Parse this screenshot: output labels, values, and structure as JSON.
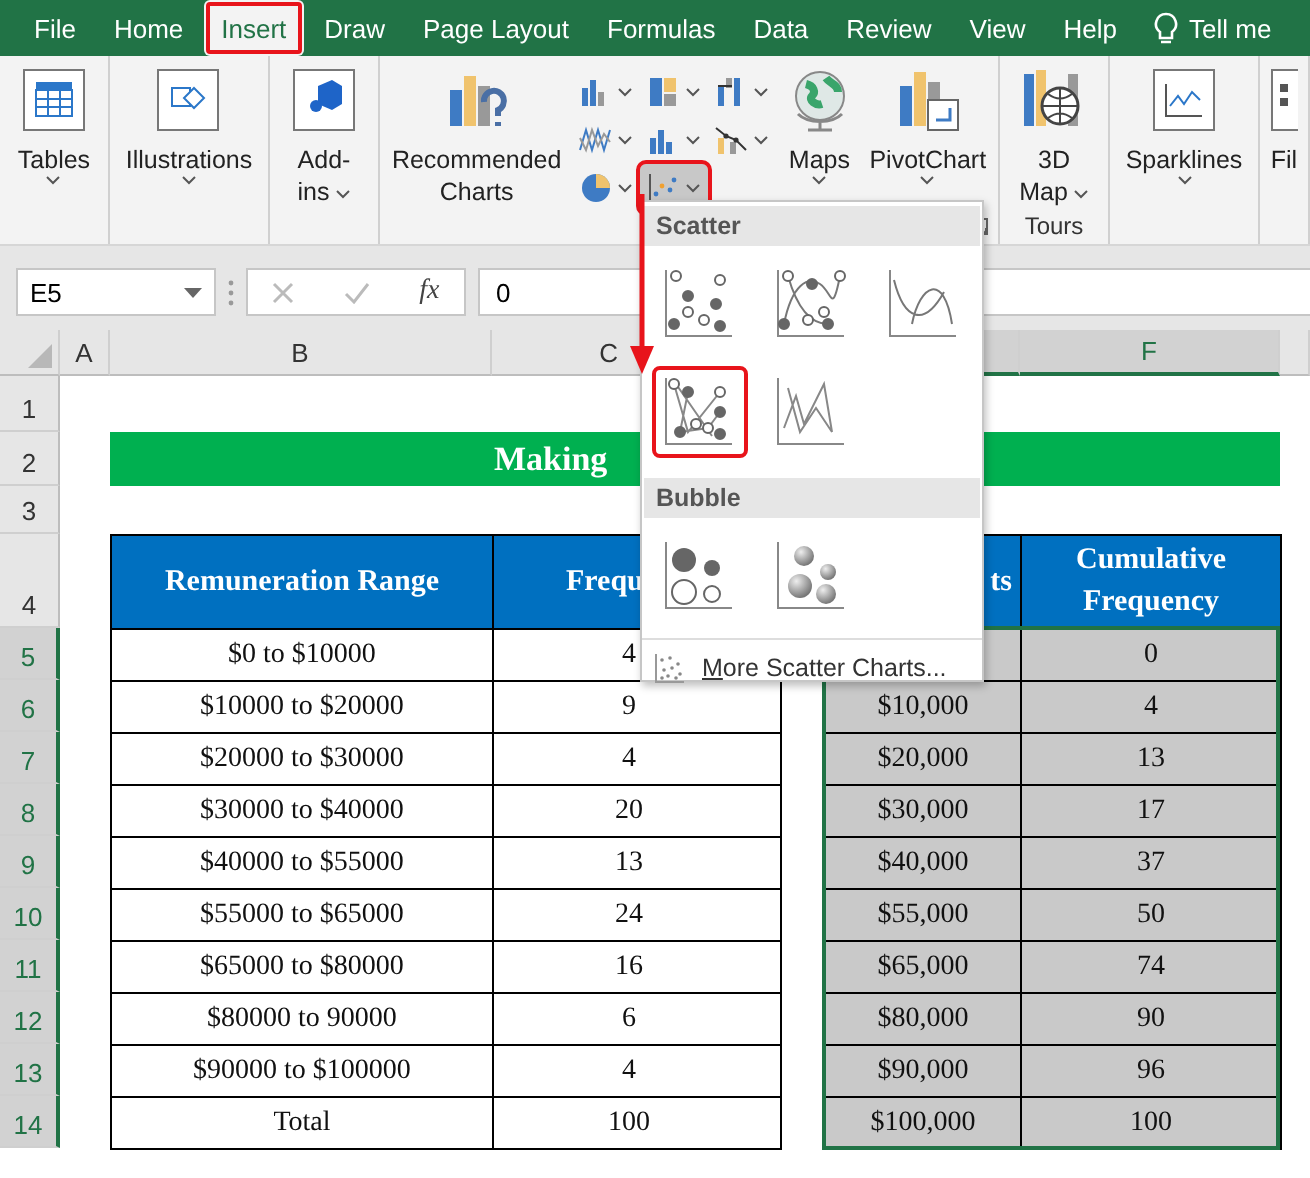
{
  "tabs": [
    {
      "label": "File",
      "selected": false
    },
    {
      "label": "Home",
      "selected": false
    },
    {
      "label": "Insert",
      "selected": true
    },
    {
      "label": "Draw",
      "selected": false
    },
    {
      "label": "Page Layout",
      "selected": false
    },
    {
      "label": "Formulas",
      "selected": false
    },
    {
      "label": "Data",
      "selected": false
    },
    {
      "label": "Review",
      "selected": false
    },
    {
      "label": "View",
      "selected": false
    },
    {
      "label": "Help",
      "selected": false
    }
  ],
  "tell_me": "Tell me",
  "ribbon_groups": [
    {
      "buttons": [
        {
          "kind": "big",
          "label_lines": [
            "Tables"
          ],
          "caret_below": true
        }
      ]
    },
    {
      "buttons": [
        {
          "kind": "big",
          "label_lines": [
            "Illustrations"
          ],
          "caret_below": true
        }
      ]
    },
    {
      "buttons": [
        {
          "kind": "big",
          "label_lines": [
            "Add-",
            "ins"
          ],
          "caret_inline": true
        }
      ]
    },
    {
      "launcher": true,
      "buttons": [
        {
          "kind": "big",
          "label_lines": [
            "Recommended",
            "Charts"
          ]
        },
        {
          "kind": "grid",
          "items": [
            {
              "selected": false
            },
            {
              "selected": false
            },
            {
              "selected": false
            },
            {
              "selected": false
            },
            {
              "selected": false
            },
            {
              "selected": false
            },
            {
              "selected": false
            },
            {
              "selected": true
            }
          ]
        },
        {
          "kind": "big",
          "label_lines": [
            "Maps"
          ],
          "caret_below": true
        },
        {
          "kind": "big",
          "label_lines": [
            "PivotChart"
          ],
          "caret_below": true
        }
      ]
    },
    {
      "label": "Tours",
      "buttons": [
        {
          "kind": "big",
          "label_lines": [
            "3D",
            "Map"
          ],
          "caret_inline": true
        }
      ]
    },
    {
      "buttons": [
        {
          "kind": "big",
          "label_lines": [
            "Sparklines"
          ],
          "caret_below": true
        }
      ]
    },
    {
      "buttons": [
        {
          "kind": "big",
          "label_lines": [
            "Fil"
          ]
        }
      ]
    }
  ],
  "name_box": "E5",
  "function_button": "fx",
  "formula": "0",
  "column_headers": [
    {
      "label": "A",
      "selected": false
    },
    {
      "label": "B",
      "selected": false
    },
    {
      "label": "C",
      "selected": false
    },
    {
      "label": "F",
      "selected": true
    }
  ],
  "row_numbers": [
    {
      "label": "1",
      "selected": false
    },
    {
      "label": "2",
      "selected": false
    },
    {
      "label": "3",
      "selected": false
    },
    {
      "label": "4",
      "selected": false
    },
    {
      "label": "5",
      "selected": true
    },
    {
      "label": "6",
      "selected": true
    },
    {
      "label": "7",
      "selected": true
    },
    {
      "label": "8",
      "selected": true
    },
    {
      "label": "9",
      "selected": true
    },
    {
      "label": "10",
      "selected": true
    },
    {
      "label": "11",
      "selected": true
    },
    {
      "label": "12",
      "selected": true
    },
    {
      "label": "13",
      "selected": true
    },
    {
      "label": "14",
      "selected": true
    }
  ],
  "title": "Making",
  "left_table": {
    "headers": [
      "Remuneration Range",
      "Frequ"
    ],
    "rows": [
      [
        "$0 to $10000",
        "4"
      ],
      [
        "$10000 to $20000",
        "9"
      ],
      [
        "$20000 to $30000",
        "4"
      ],
      [
        "$30000 to $40000",
        "20"
      ],
      [
        "$40000 to $55000",
        "13"
      ],
      [
        "$55000 to $65000",
        "24"
      ],
      [
        "$65000 to $80000",
        "16"
      ],
      [
        "$80000 to 90000",
        "6"
      ],
      [
        "$90000 to $100000",
        "4"
      ],
      [
        "Total",
        "100"
      ]
    ]
  },
  "right_table": {
    "headers": [
      "ts",
      "Cumulative Frequency"
    ],
    "rows": [
      {
        "cumulative": "0"
      },
      {
        "limit": "$10,000",
        "cumulative": "4"
      },
      {
        "limit": "$20,000",
        "cumulative": "13"
      },
      {
        "limit": "$30,000",
        "cumulative": "17"
      },
      {
        "limit": "$40,000",
        "cumulative": "37"
      },
      {
        "limit": "$55,000",
        "cumulative": "50"
      },
      {
        "limit": "$65,000",
        "cumulative": "74"
      },
      {
        "limit": "$80,000",
        "cumulative": "90"
      },
      {
        "limit": "$90,000",
        "cumulative": "96"
      },
      {
        "limit": "$100,000",
        "cumulative": "100"
      }
    ]
  },
  "dropdown": {
    "sections": [
      {
        "title": "Scatter",
        "items": [
          {
            "kind": "markers",
            "selected": false
          },
          {
            "kind": "smooth-markers",
            "selected": false
          },
          {
            "kind": "smooth",
            "selected": false
          },
          {
            "kind": "lines-markers",
            "selected": true
          },
          {
            "kind": "lines",
            "selected": false
          }
        ]
      },
      {
        "title": "Bubble",
        "items": [
          {
            "kind": "bubble",
            "selected": false
          },
          {
            "kind": "bubble-3d",
            "selected": false
          }
        ]
      }
    ],
    "more": "More Scatter Charts..."
  }
}
